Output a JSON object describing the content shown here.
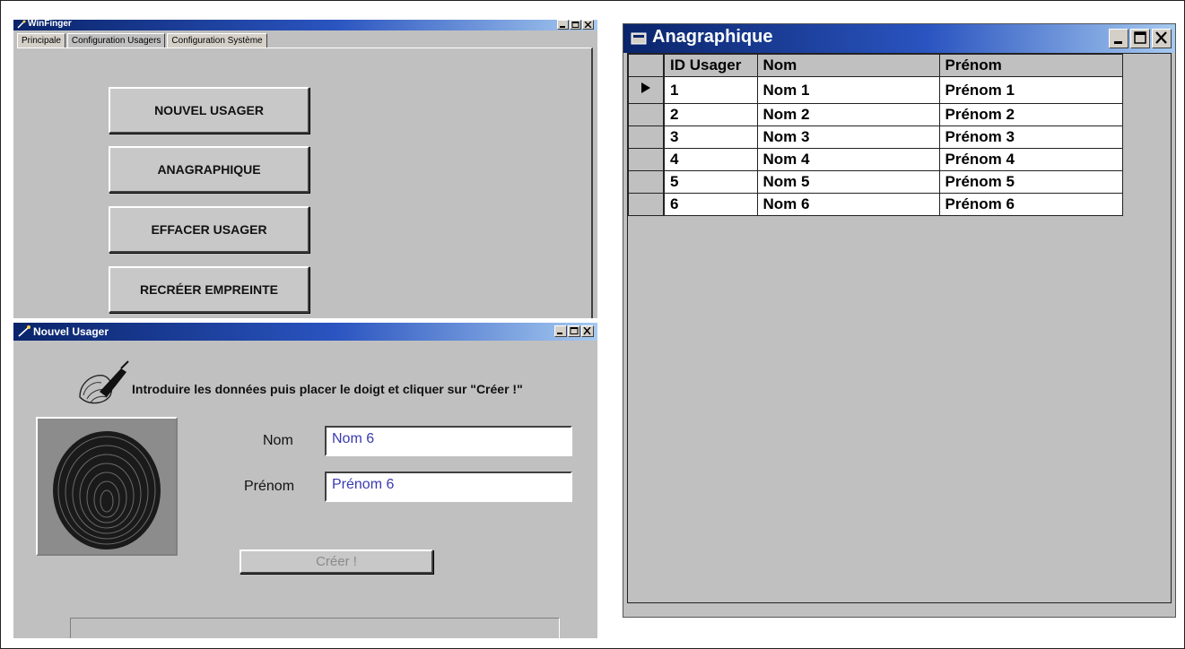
{
  "colors": {
    "title_start": "#0a246a",
    "title_end": "#a6caf0",
    "window_bg": "#c0c0c0",
    "input_text": "#3a3ab0"
  },
  "winfinger": {
    "title": "WinFinger",
    "tabs": [
      "Principale",
      "Configuration Usagers",
      "Configuration Système"
    ],
    "active_tab": 1,
    "buttons": {
      "nouvel_usager": "NOUVEL USAGER",
      "anagraphique": "ANAGRAPHIQUE",
      "effacer_usager": "EFFACER USAGER",
      "recreer_empreinte": "RECRÉER EMPREINTE"
    }
  },
  "nouvel_usager": {
    "title": "Nouvel Usager",
    "instruction": "Introduire les données puis placer le doigt et cliquer sur \"Créer !\"",
    "nom_label": "Nom",
    "nom_value": "Nom 6",
    "prenom_label": "Prénom",
    "prenom_value": "Prénom 6",
    "creer_label": "Créer !"
  },
  "anagraphique": {
    "title": "Anagraphique",
    "columns": [
      "ID Usager",
      "Nom",
      "Prénom"
    ],
    "current_row": 0,
    "rows": [
      {
        "id": "1",
        "nom": "Nom 1",
        "prenom": "Prénom 1"
      },
      {
        "id": "2",
        "nom": "Nom 2",
        "prenom": "Prénom 2"
      },
      {
        "id": "3",
        "nom": "Nom 3",
        "prenom": "Prénom 3"
      },
      {
        "id": "4",
        "nom": "Nom 4",
        "prenom": "Prénom 4"
      },
      {
        "id": "5",
        "nom": "Nom 5",
        "prenom": "Prénom 5"
      },
      {
        "id": "6",
        "nom": "Nom 6",
        "prenom": "Prénom 6"
      }
    ]
  }
}
